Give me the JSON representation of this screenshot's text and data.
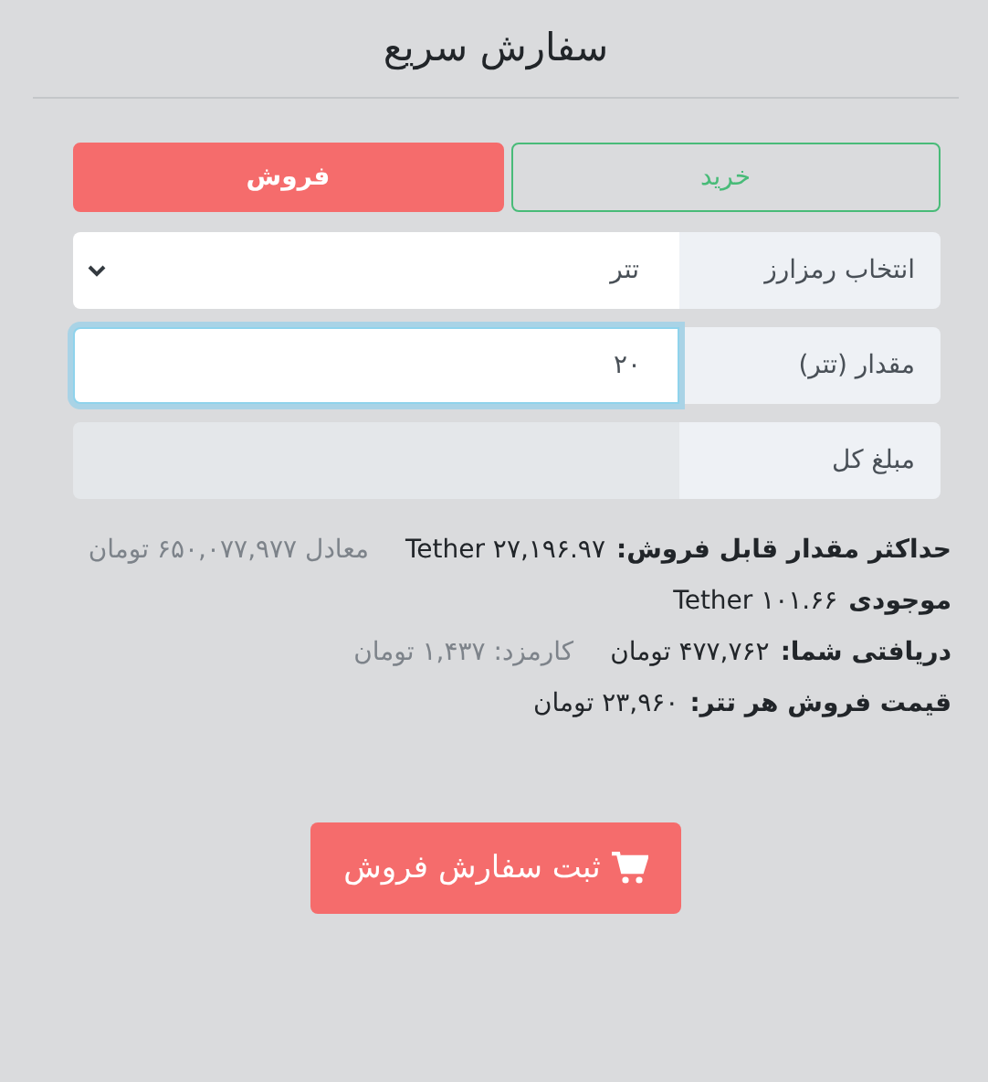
{
  "title": "سفارش سریع",
  "tabs": [
    {
      "label": "خرید",
      "selected": false,
      "color": "#48bb78"
    },
    {
      "label": "فروش",
      "selected": true,
      "color": "#f56c6c"
    }
  ],
  "fields": [
    {
      "kind": "select",
      "label": "انتخاب رمزارز",
      "value": "تتر",
      "focused": false
    },
    {
      "kind": "input",
      "label": "مقدار (تتر)",
      "value": "۲۰",
      "focused": true
    },
    {
      "kind": "readonly",
      "label": "مبلغ کل",
      "focused": false
    }
  ],
  "info": [
    {
      "label": "حداکثر مقدار قابل فروش:",
      "value": "Tether ۲۷,۱۹۶.۹۷",
      "note": "معادل ۶۵۰,۰۷۷,۹۷۷ تومان"
    },
    {
      "label": "موجودی",
      "value": "Tether ۱۰۱.۶۶"
    },
    {
      "label": "دریافتی شما:",
      "value": "۴۷۷,۷۶۲ تومان",
      "note": "کارمزد: ۱,۴۳۷ تومان"
    },
    {
      "label": "قیمت فروش هر تتر:",
      "value": "۲۳,۹۶۰ تومان"
    }
  ],
  "submit": {
    "label": "ثبت سفارش فروش"
  }
}
